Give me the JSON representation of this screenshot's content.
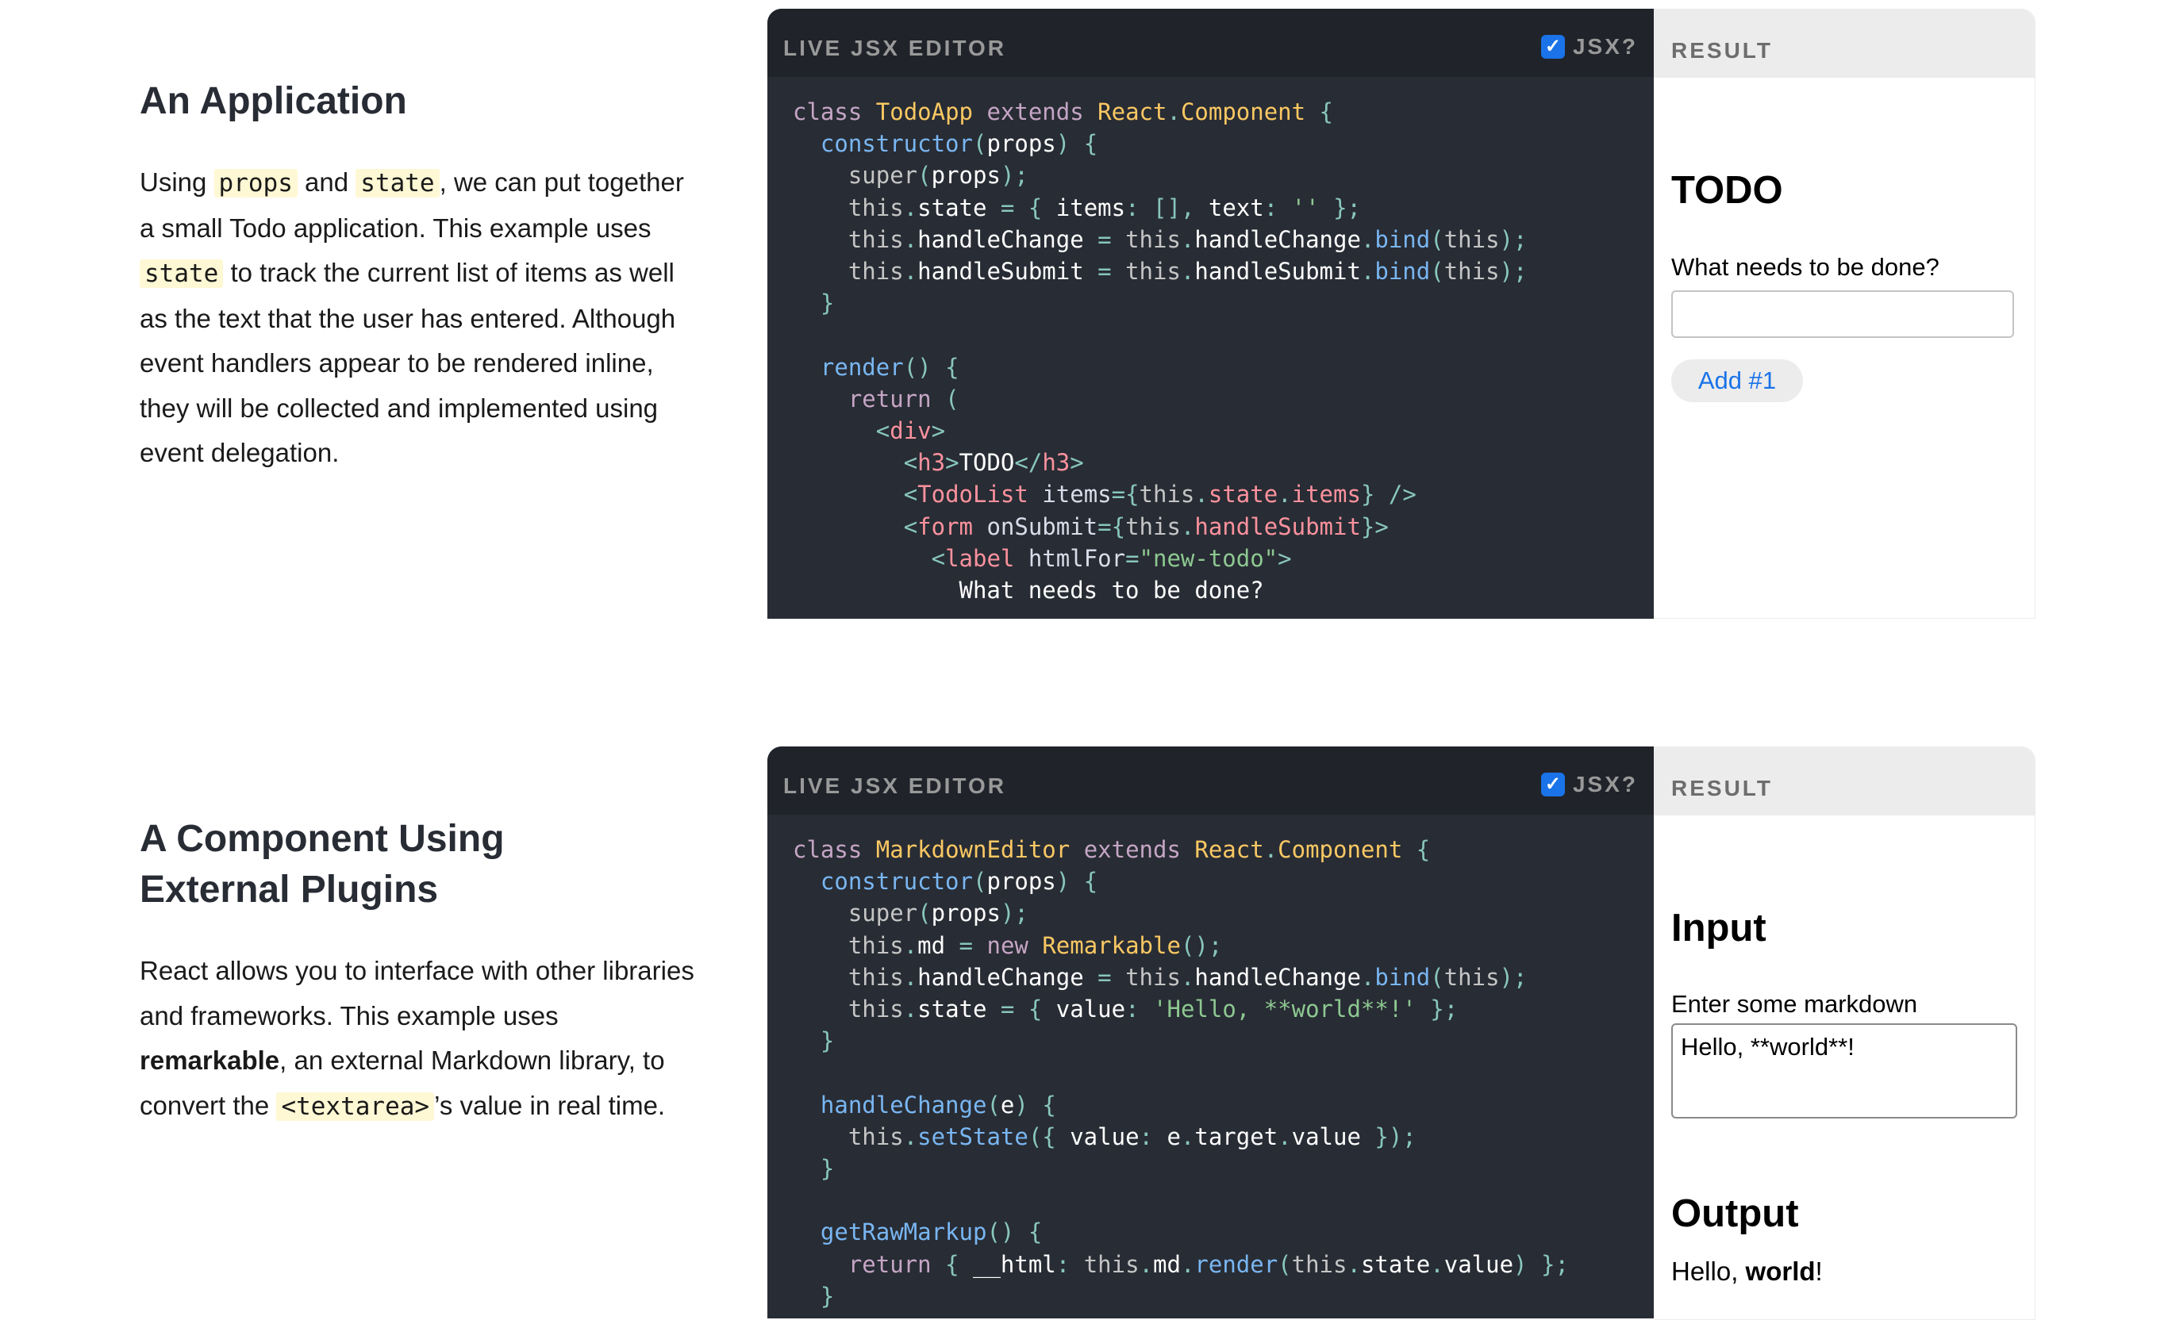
{
  "sections": [
    {
      "heading": "An Application",
      "paragraph": {
        "p1": "Using ",
        "c1": "props",
        "p2": " and ",
        "c2": "state",
        "p3": ", we can put together a small Todo application. This example uses ",
        "c3": "state",
        "p4": " to track the current list of items as well as the text that the user has entered. Although event handlers appear to be rendered inline, they will be collected and implemented using event delegation."
      },
      "editor": {
        "title": "LIVE JSX EDITOR",
        "jsx_label": "JSX?",
        "jsx_checked": true
      },
      "result": {
        "title": "RESULT",
        "h3": "TODO",
        "label": "What needs to be done?",
        "input_value": "",
        "button": "Add #1"
      }
    },
    {
      "heading_line1": "A Component Using",
      "heading_line2": "External Plugins",
      "paragraph": {
        "p1": "React allows you to interface with other libraries and frameworks. This example uses ",
        "b1": "remarkable",
        "p2": ", an external Markdown library, to convert the ",
        "c1": "<textarea>",
        "p3": "’s value in real time."
      },
      "editor": {
        "title": "LIVE JSX EDITOR",
        "jsx_label": "JSX?",
        "jsx_checked": true
      },
      "result": {
        "title": "RESULT",
        "input_heading": "Input",
        "label": "Enter some markdown",
        "textarea_value": "Hello, **world**!",
        "output_heading": "Output",
        "output_text_before": "Hello, ",
        "output_bold": "world",
        "output_text_after": "!"
      }
    }
  ],
  "icons": {
    "checkbox": "checkmark-icon"
  },
  "colors": {
    "editor_bg": "#282c34",
    "editor_header_bg": "#20232a",
    "result_header_bg": "#ececec",
    "accent_blue": "#1a73e8",
    "code_highlight": "#fff9db"
  }
}
